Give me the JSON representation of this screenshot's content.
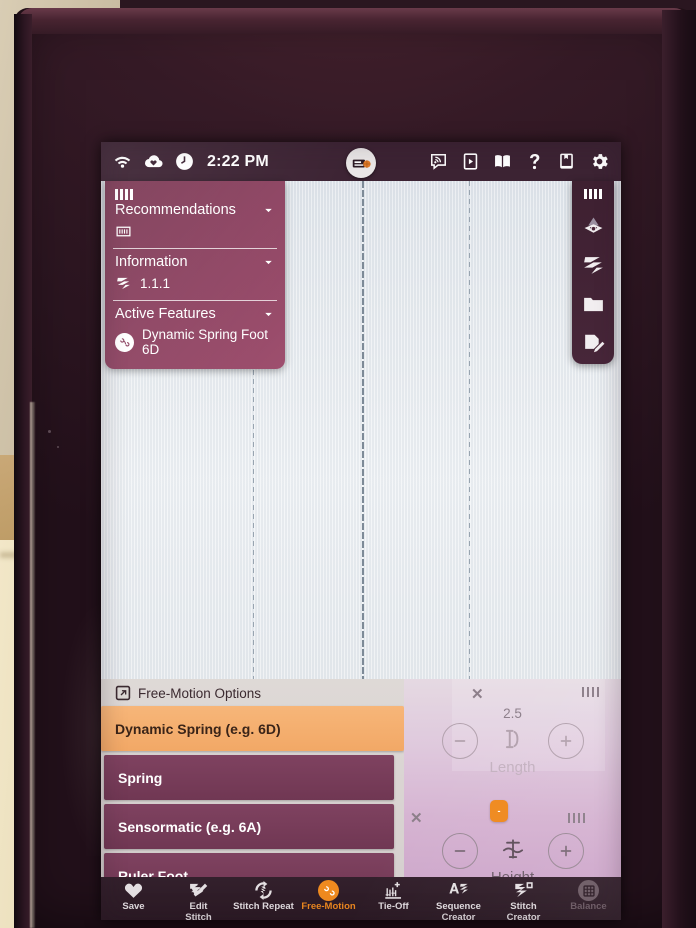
{
  "statusbar": {
    "time": "2:22 PM",
    "icons_left": [
      "wifi-icon",
      "cloud-icon",
      "clock-icon"
    ],
    "center_icon": "sewing-machine-icon",
    "icons_right": [
      "wifi-broadcast-icon",
      "video-tutorial-icon",
      "manual-book-icon",
      "help-icon",
      "bookmark-icon",
      "settings-gear-icon"
    ]
  },
  "info_panel": {
    "recommendations": {
      "label": "Recommendations",
      "chevron": "chevron-down-icon",
      "bars_icon": "stitch-bars-icon",
      "value_icon": "presser-foot-icon"
    },
    "information": {
      "label": "Information",
      "chevron": "chevron-down-icon",
      "value": "1.1.1",
      "value_icon": "stitch-pattern-icon"
    },
    "active_features": {
      "label": "Active Features",
      "chevron": "chevron-down-icon",
      "items": [
        {
          "label": "Dynamic Spring Foot 6D",
          "icon": "free-motion-icon"
        }
      ]
    }
  },
  "vertical_toolbar": {
    "items": [
      {
        "name": "stitch-bars-icon"
      },
      {
        "name": "presser-foot-pressure-icon"
      },
      {
        "name": "stitch-pattern-icon"
      },
      {
        "name": "folder-icon"
      },
      {
        "name": "edit-document-icon"
      }
    ]
  },
  "free_motion": {
    "title": "Free-Motion Options",
    "title_icon": "popup-window-icon",
    "options": [
      {
        "label": "Dynamic Spring (e.g. 6D)",
        "selected": true
      },
      {
        "label": "Spring",
        "selected": false
      },
      {
        "label": "Sensormatic (e.g. 6A)",
        "selected": false
      },
      {
        "label": "Ruler Foot",
        "selected": false
      }
    ]
  },
  "controls": {
    "length": {
      "label": "Length",
      "value": "2.5",
      "enabled": false,
      "close_icon": "close-x-icon",
      "bars_icon": "stitch-bars-icon",
      "minus_label": "minus-icon",
      "plus_label": "plus-icon",
      "mid_icon": "stitch-length-icon"
    },
    "height": {
      "label": "Height",
      "badge_value": "-",
      "enabled": true,
      "close_icon": "close-x-icon",
      "bars_icon": "stitch-bars-icon",
      "minus_label": "minus-icon",
      "plus_label": "plus-icon",
      "mid_icon": "stitch-height-icon"
    }
  },
  "navbar": {
    "items": [
      {
        "label": "Save",
        "icon": "heart-icon",
        "state": "normal"
      },
      {
        "label": "Edit\nStitch",
        "icon": "edit-stitch-icon",
        "state": "normal"
      },
      {
        "label": "Stitch Repeat",
        "icon": "stitch-repeat-icon",
        "state": "normal"
      },
      {
        "label": "Free-Motion",
        "icon": "free-motion-icon",
        "state": "active"
      },
      {
        "label": "Tie-Off",
        "icon": "tie-off-icon",
        "state": "normal"
      },
      {
        "label": "Sequence\nCreator",
        "icon": "sequence-creator-icon",
        "state": "normal"
      },
      {
        "label": "Stitch\nCreator",
        "icon": "stitch-creator-icon",
        "state": "normal"
      },
      {
        "label": "Balance",
        "icon": "balance-icon",
        "state": "disabled"
      }
    ]
  },
  "colors": {
    "header_plum": "#3c2333",
    "panel_magenta": "#8d4462",
    "accent_orange": "#ef8a1f",
    "selected_orange": "#f2a866",
    "option_plum": "#7f4260",
    "canvas": "#e7ebef"
  }
}
